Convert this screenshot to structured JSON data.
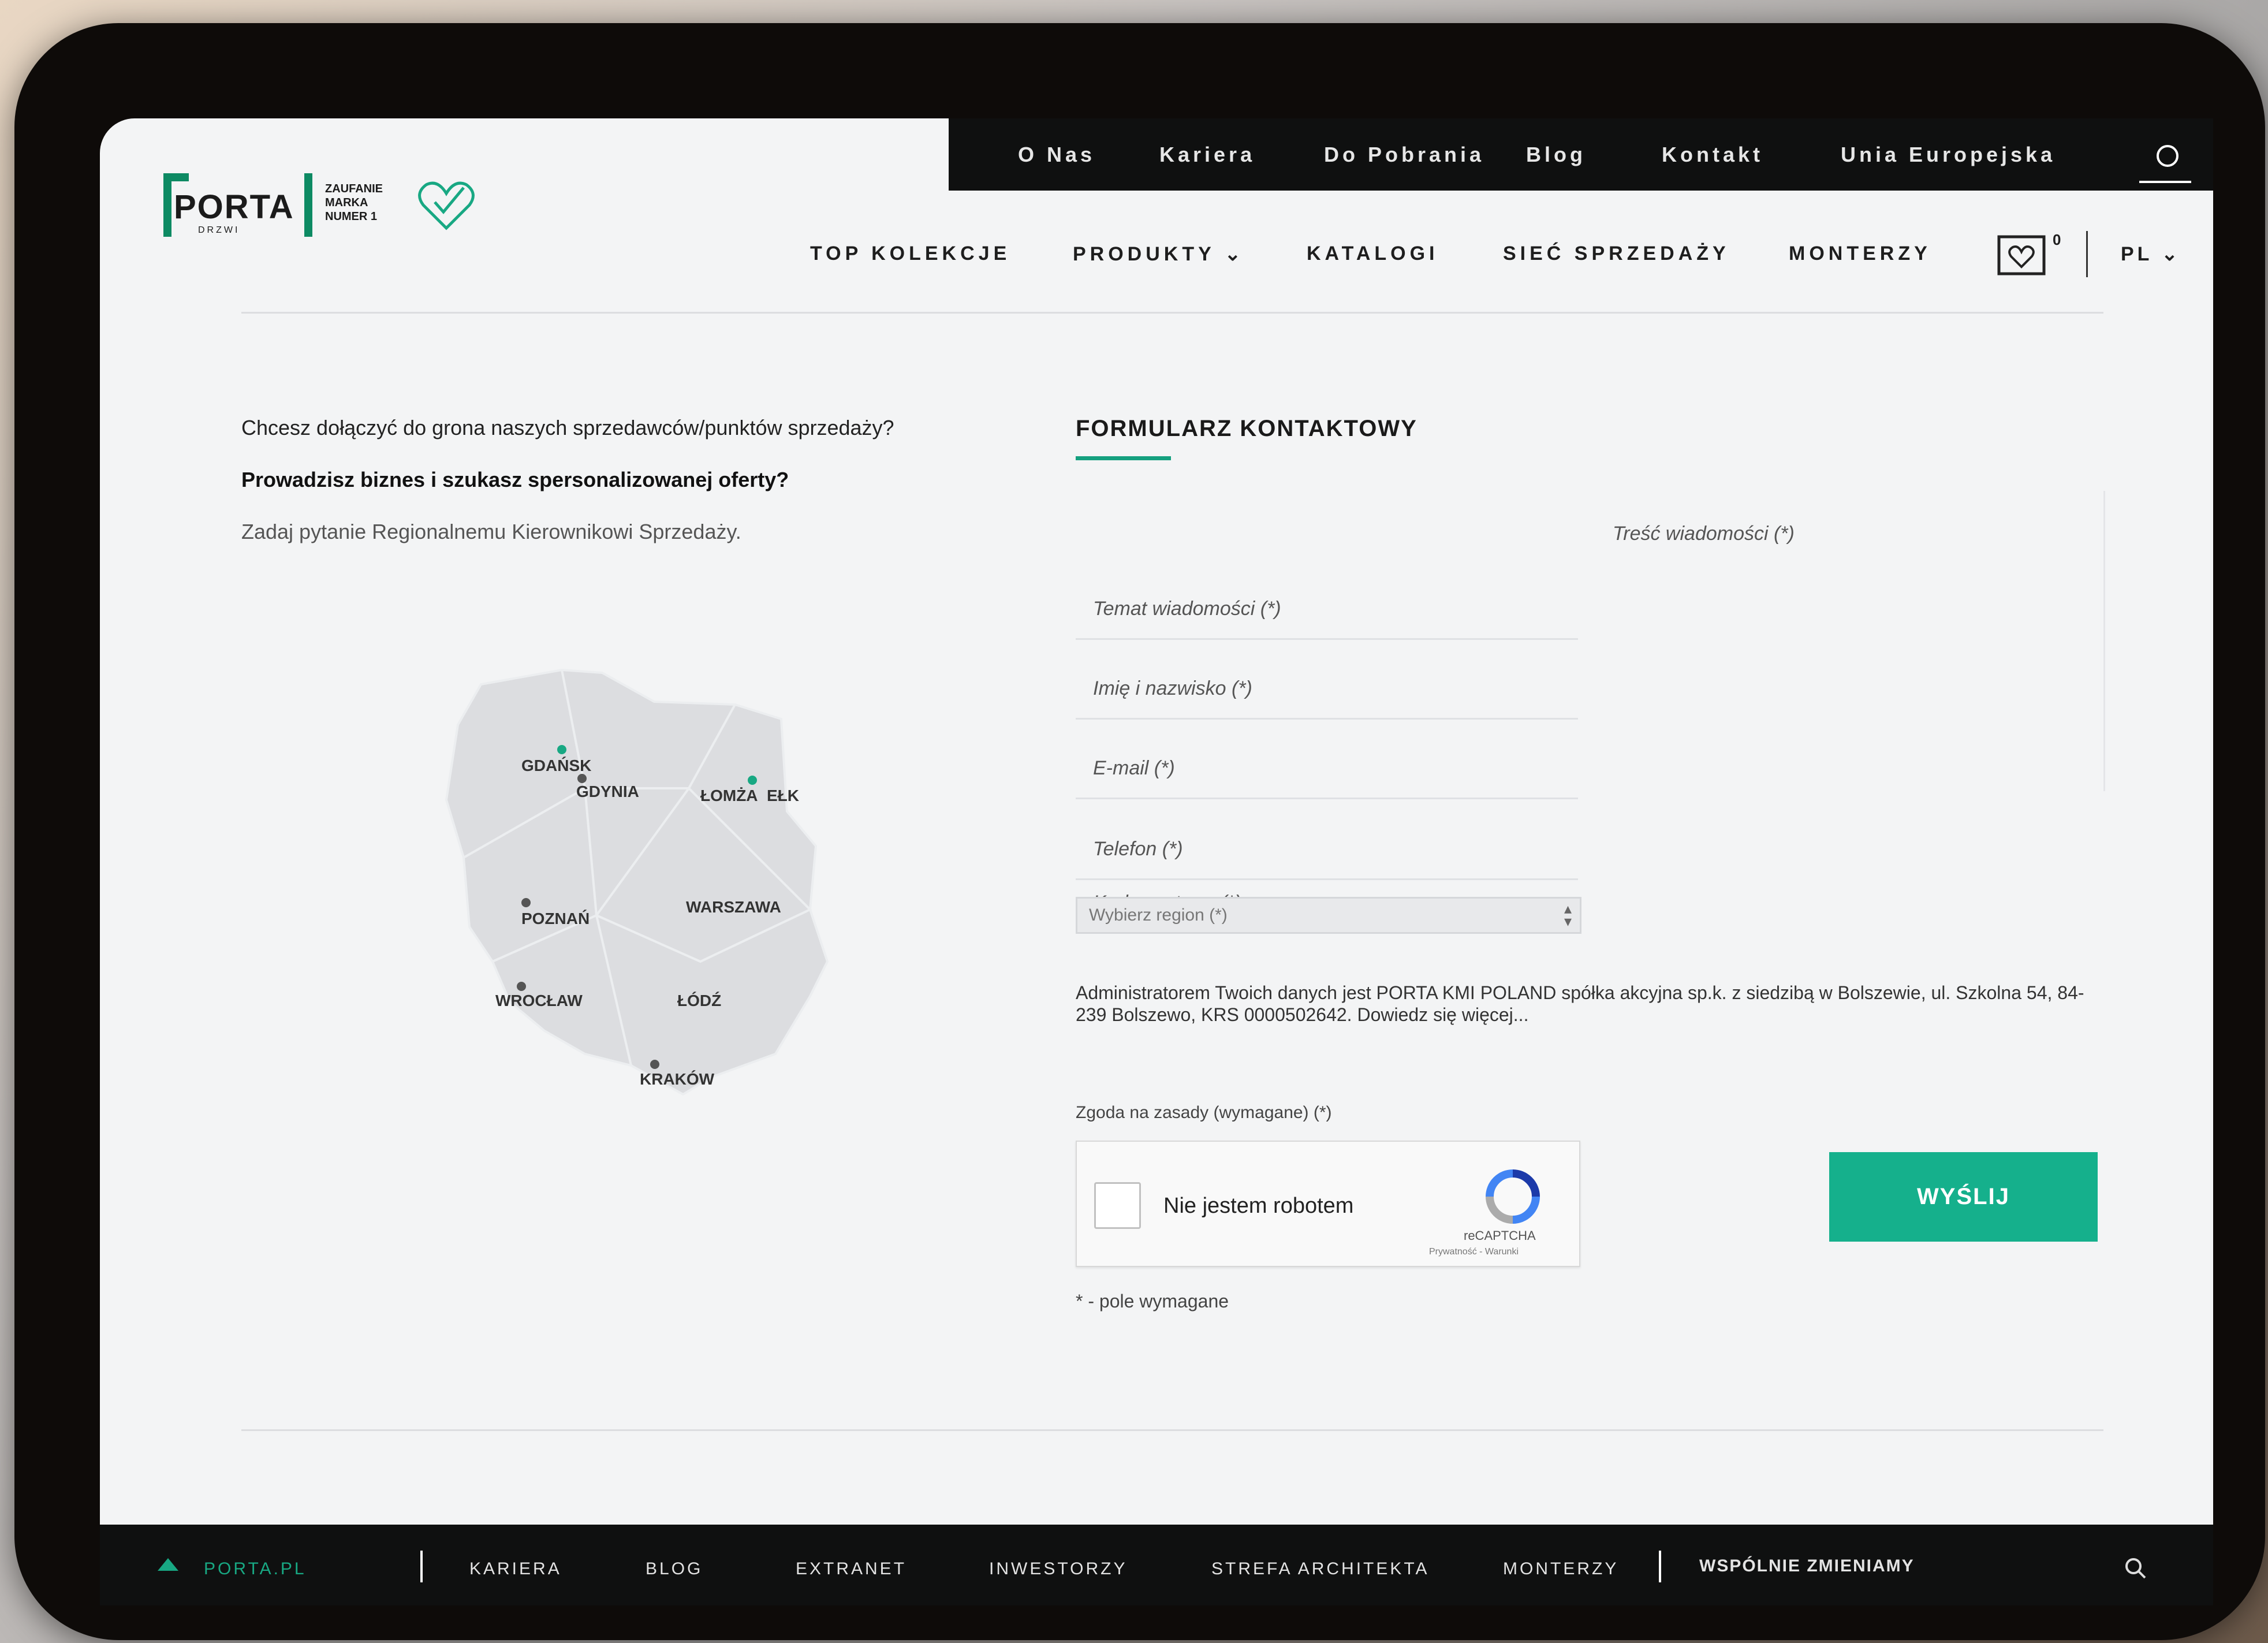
{
  "top_bar": {
    "links": [
      {
        "label": "O Nas"
      },
      {
        "label": "Kariera"
      },
      {
        "label": "Do Pobrania"
      },
      {
        "label": "Blog"
      },
      {
        "label": "Kontakt"
      },
      {
        "label": "Unia Europejska"
      }
    ]
  },
  "logo": {
    "text": "PORTA",
    "sub": "DRZWI",
    "tagline_1": "ZAUFANIE",
    "tagline_2": "MARKA",
    "tagline_3": "NUMER 1"
  },
  "nav": {
    "items": [
      {
        "label": "TOP KOLEKCJE"
      },
      {
        "label": "PRODUKTY"
      },
      {
        "label": "KATALOGI"
      },
      {
        "label": "SIEĆ SPRZEDAŻY"
      },
      {
        "label": "MONTERZY"
      }
    ],
    "cart_count": "0",
    "language": "PL"
  },
  "intro": {
    "line1": "Chcesz dołączyć do grona naszych sprzedawców/punktów sprzedaży?",
    "line2": "Prowadzisz biznes i szukasz spersonalizowanej oferty?",
    "line3": "Zadaj pytanie Regionalnemu Kierownikowi Sprzedaży."
  },
  "map": {
    "cities": [
      {
        "label": "GDAŃSK"
      },
      {
        "label": "GDYNIA"
      },
      {
        "label": "ŁOMŻA"
      },
      {
        "label": "EŁK"
      },
      {
        "label": "POZNAŃ"
      },
      {
        "label": "WARSZAWA"
      },
      {
        "label": "WROCŁAW"
      },
      {
        "label": "ŁÓDŹ"
      },
      {
        "label": "KRAKÓW"
      }
    ],
    "land_color": "#dcdde0",
    "pin_color": "#555555",
    "accent_pin_color": "#18a883"
  },
  "form": {
    "title": "FORMULARZ KONTAKTOWY",
    "subject_placeholder": "Temat wiadomości (*)",
    "name_placeholder": "Imię i nazwisko (*)",
    "email_placeholder": "E-mail (*)",
    "phone_placeholder": "Telefon (*)",
    "postcode_placeholder": "Kod pocztowy (*)",
    "region_placeholder": "Wybierz region (*)",
    "message_placeholder": "Treść wiadomości (*)",
    "gdpr_text": "Administratorem Twoich danych jest PORTA KMI POLAND spółka akcyjna sp.k. z siedzibą w Bolszewie, ul. Szkolna 54, 84-239 Bolszewo, KRS 0000502642. Dowiedz się więcej...",
    "consent_label": "Zgoda na zasady (wymagane) (*)",
    "captcha_label": "Nie jestem robotem",
    "captcha_brand": "reCAPTCHA",
    "captcha_terms": "Prywatność - Warunki",
    "submit_label": "WYŚLIJ",
    "required_note": "* - pole wymagane",
    "accent_color": "#15b08c"
  },
  "footer": {
    "items": [
      {
        "label": "PORTA.PL"
      },
      {
        "label": "KARIERA"
      },
      {
        "label": "BLOG"
      },
      {
        "label": "EXTRANET"
      },
      {
        "label": "INWESTORZY"
      },
      {
        "label": "STREFA ARCHITEKTA"
      },
      {
        "label": "MONTERZY"
      },
      {
        "label": "WSPÓLNIE ZMIENIAMY"
      }
    ]
  }
}
